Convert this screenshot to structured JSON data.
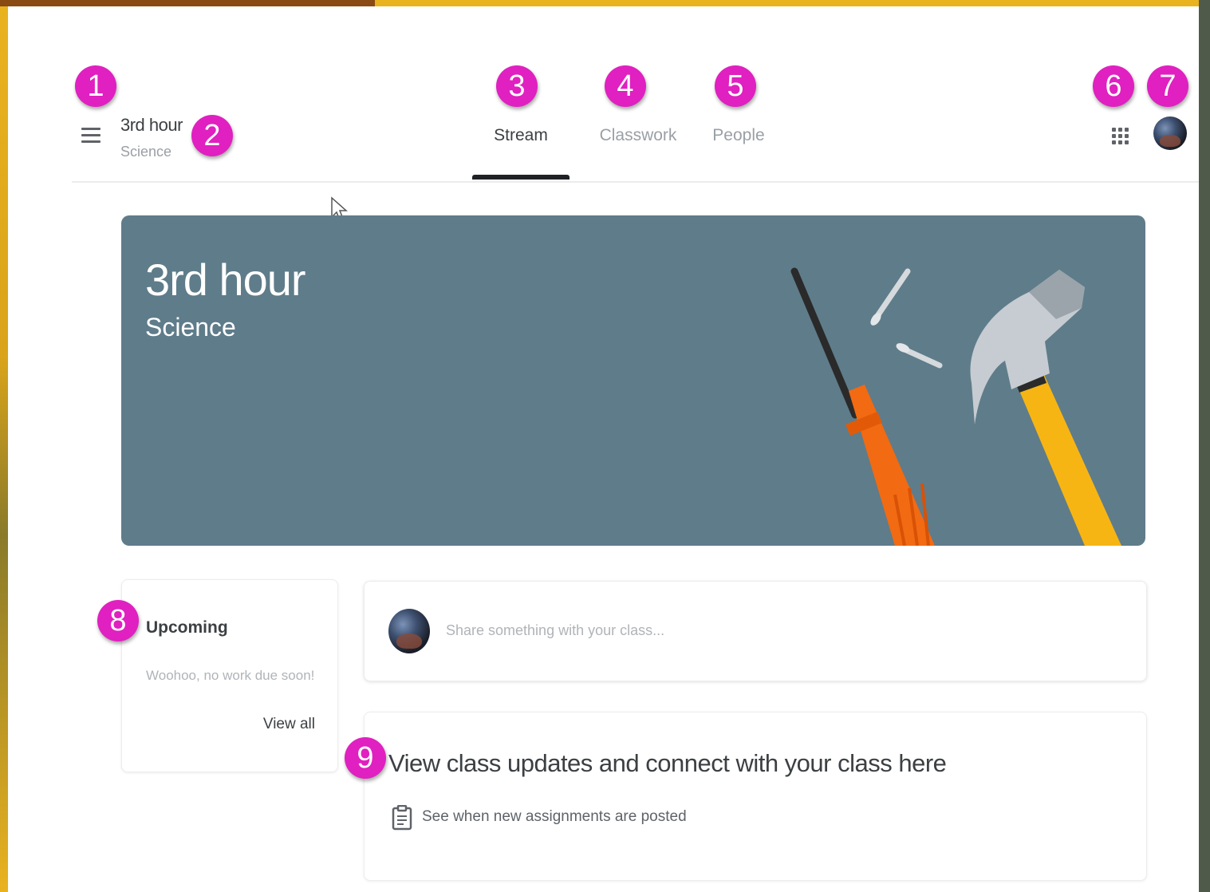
{
  "header": {
    "class_name": "3rd hour",
    "class_section": "Science",
    "tabs": [
      {
        "label": "Stream",
        "active": true
      },
      {
        "label": "Classwork",
        "active": false
      },
      {
        "label": "People",
        "active": false
      }
    ],
    "icons": {
      "menu": "hamburger-menu-icon",
      "apps": "apps-grid-icon",
      "account": "account-avatar"
    }
  },
  "banner": {
    "title": "3rd hour",
    "subtitle": "Science",
    "background_color": "#5f7c8a",
    "illustration": "tools-illustration"
  },
  "upcoming": {
    "title": "Upcoming",
    "empty_message": "Woohoo, no work due soon!",
    "view_all": "View all"
  },
  "share": {
    "placeholder": "Share something with your class..."
  },
  "updates": {
    "heading": "View class updates and connect with your class here",
    "item": "See when new assignments are posted",
    "item_icon": "clipboard-icon"
  },
  "callouts": [
    "1",
    "2",
    "3",
    "4",
    "5",
    "6",
    "7",
    "8",
    "9"
  ],
  "colors": {
    "callout": "#e020c0",
    "frame": "#e9b21f",
    "tab_active": "#202124"
  }
}
